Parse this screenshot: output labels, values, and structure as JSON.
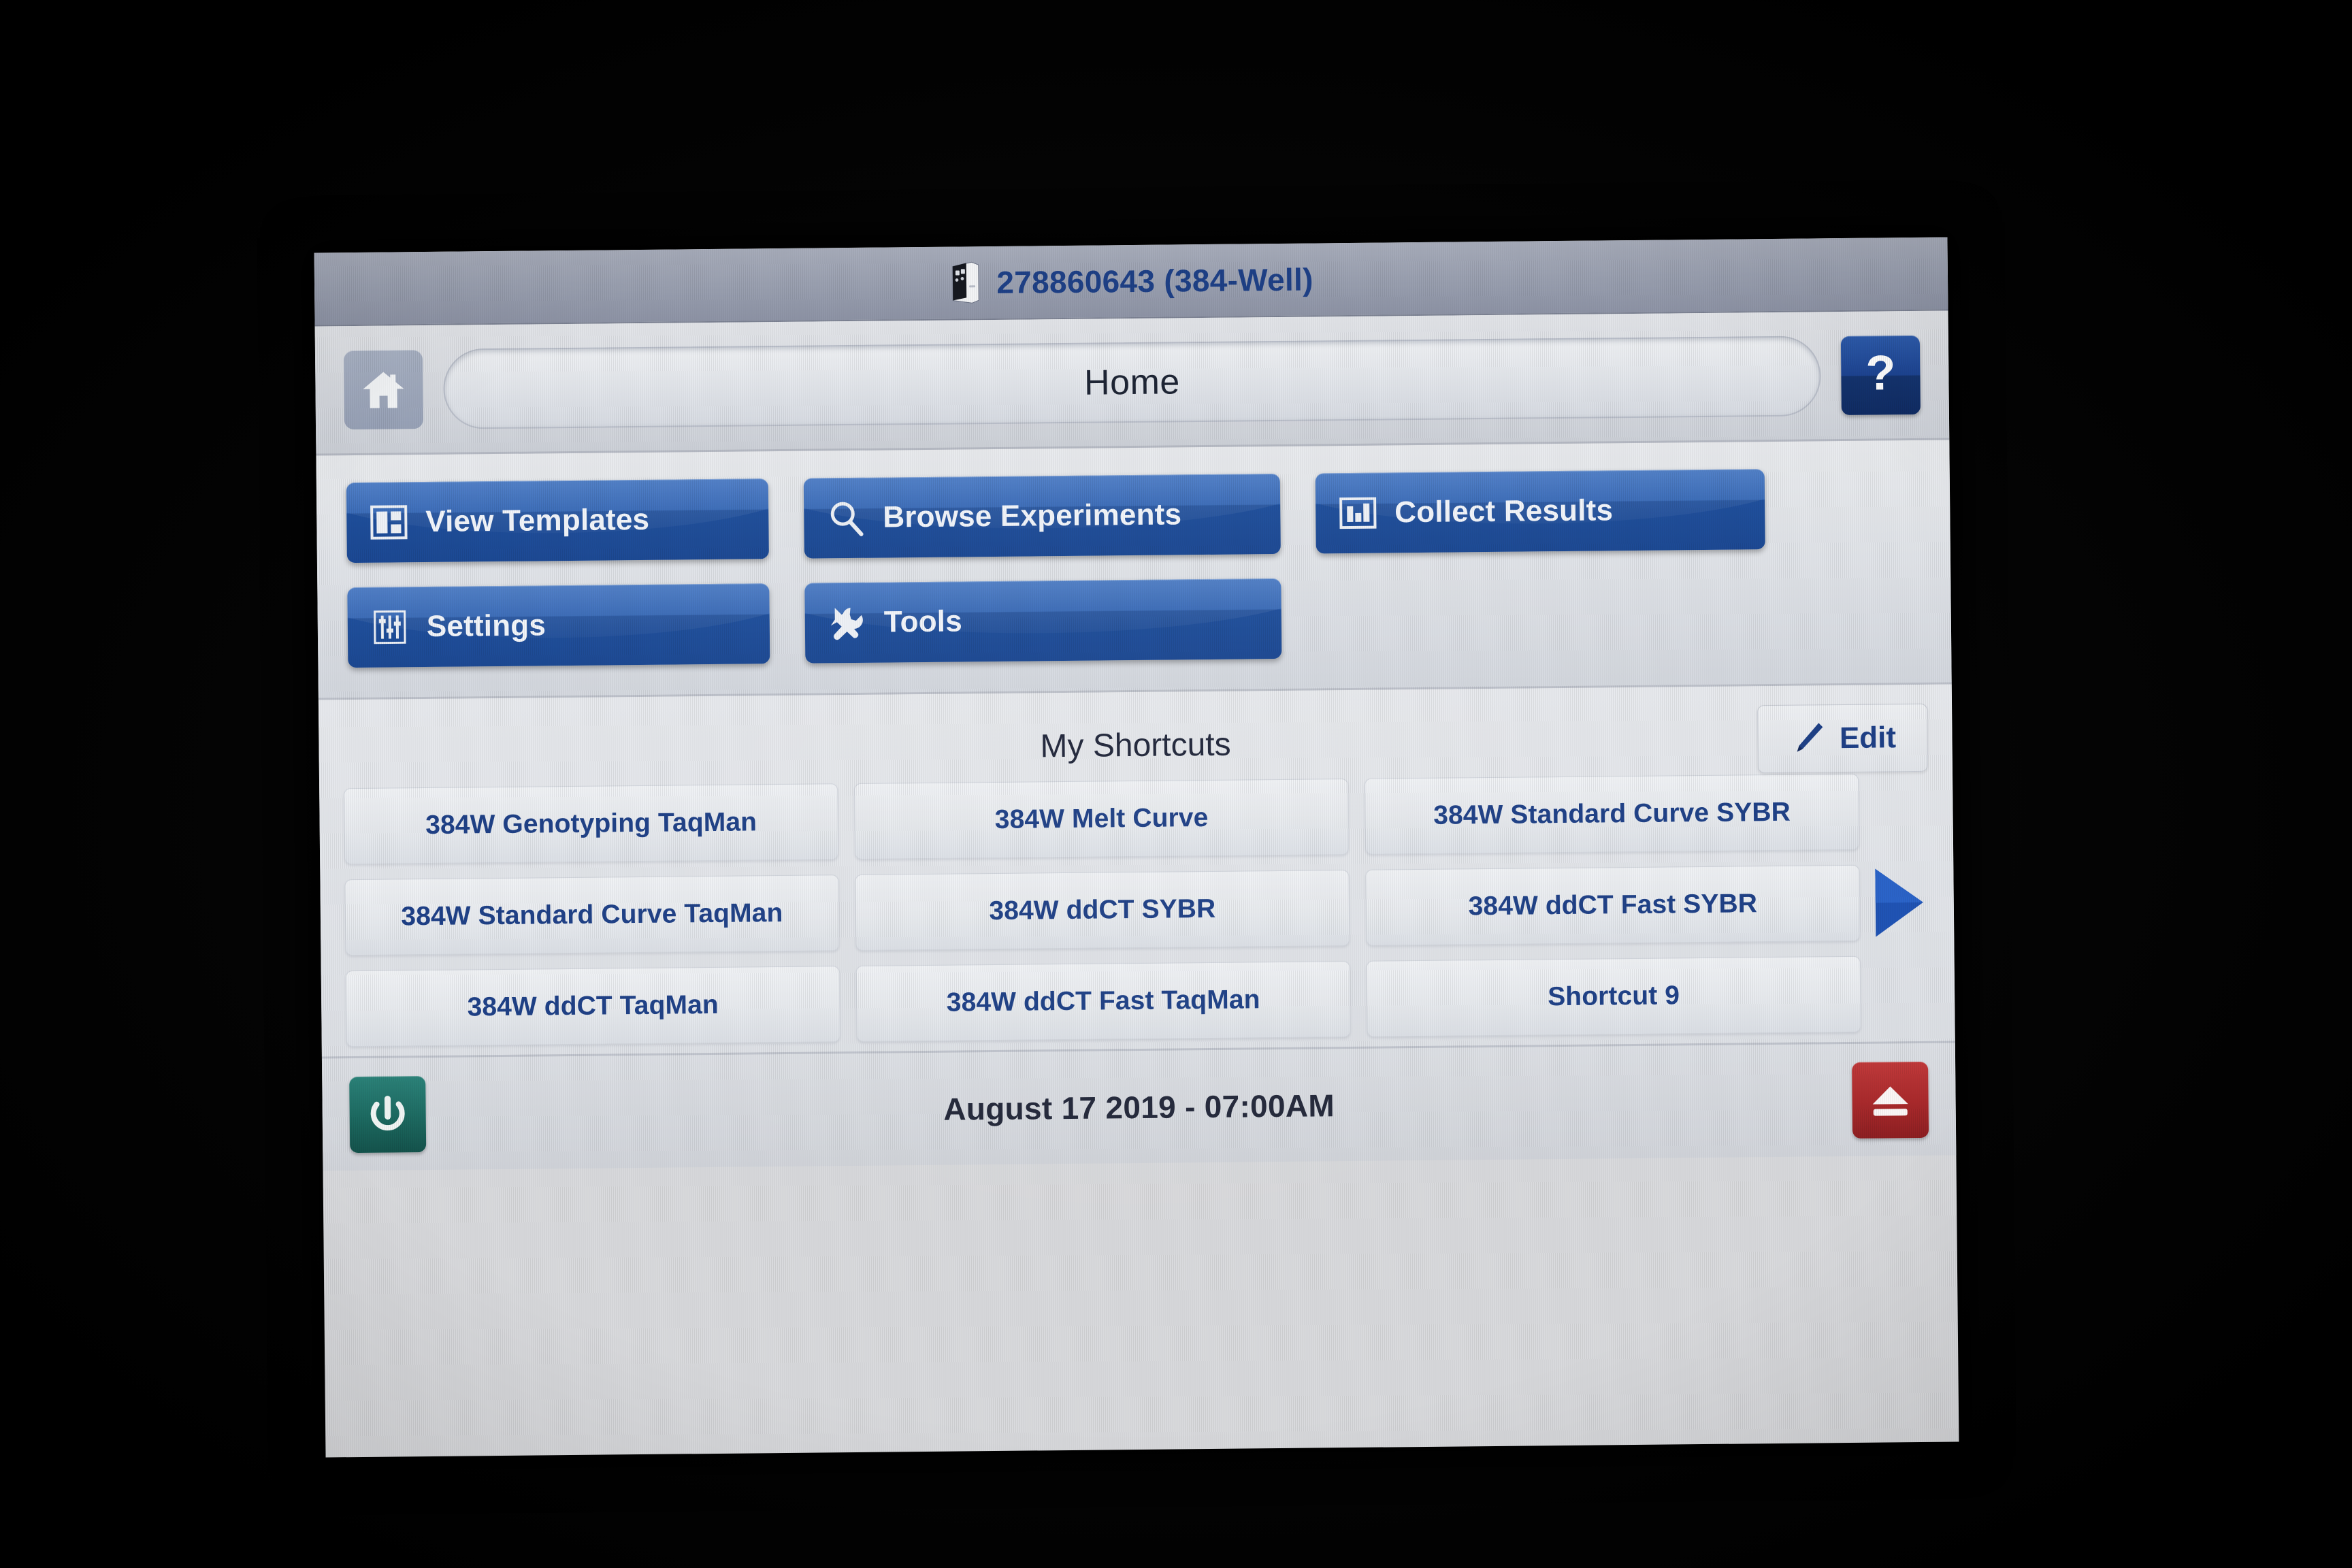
{
  "title_bar": {
    "instrument_icon": "instrument-icon",
    "text": "278860643 (384-Well)"
  },
  "nav_bar": {
    "home_icon": "home-icon",
    "page_title": "Home",
    "help_label": "?"
  },
  "actions": {
    "rows": [
      [
        {
          "label": "View Templates",
          "icon": "templates-icon",
          "width_class": "w-view-templates"
        },
        {
          "label": "Browse Experiments",
          "icon": "search-icon",
          "width_class": "w-browse-experiments"
        },
        {
          "label": "Collect Results",
          "icon": "bar-chart-icon",
          "width_class": "w-collect-results"
        }
      ],
      [
        {
          "label": "Settings",
          "icon": "sliders-icon",
          "width_class": "w-settings"
        },
        {
          "label": "Tools",
          "icon": "tools-icon",
          "width_class": "w-tools"
        }
      ]
    ]
  },
  "shortcuts": {
    "heading": "My Shortcuts",
    "edit_label": "Edit",
    "edit_icon": "pencil-icon",
    "next_page_icon": "next-page-arrow-icon",
    "tiles": [
      "384W Genotyping TaqMan",
      "384W Melt Curve",
      "384W Standard Curve SYBR",
      "384W Standard Curve TaqMan",
      "384W ddCT SYBR",
      "384W ddCT Fast SYBR",
      "384W ddCT TaqMan",
      "384W ddCT Fast TaqMan",
      "Shortcut 9"
    ]
  },
  "status_bar": {
    "power_icon": "power-icon",
    "datetime": "August 17 2019 - 07:00AM",
    "eject_icon": "eject-icon"
  },
  "colors": {
    "accent_blue": "#1d3f86",
    "button_blue": "#1f4f9c",
    "power_green": "#1d6b62",
    "eject_red": "#ab2a2c",
    "title_bar_gray": "#9aa0b0"
  }
}
